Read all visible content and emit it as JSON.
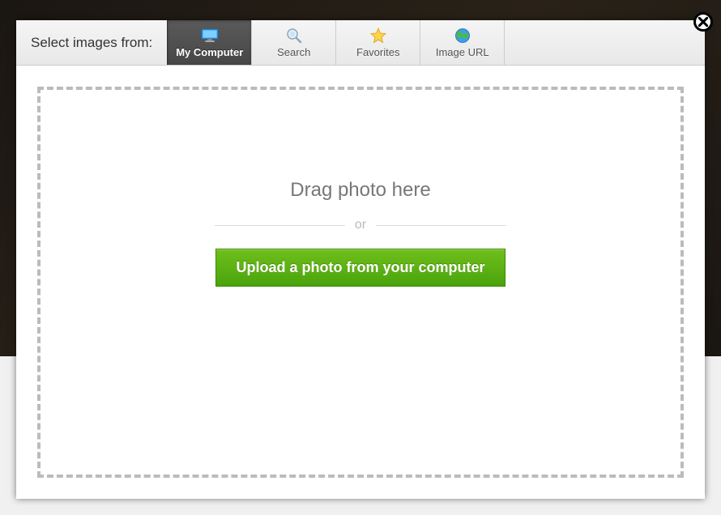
{
  "header": {
    "prompt": "Select images from:"
  },
  "tabs": [
    {
      "id": "my-computer",
      "label": "My Computer",
      "active": true
    },
    {
      "id": "search",
      "label": "Search",
      "active": false
    },
    {
      "id": "favorites",
      "label": "Favorites",
      "active": false
    },
    {
      "id": "image-url",
      "label": "Image URL",
      "active": false
    }
  ],
  "dropzone": {
    "drag_text": "Drag photo here",
    "or_text": "or",
    "upload_button": "Upload a photo from your computer"
  },
  "colors": {
    "accent_green": "#5ab411",
    "dashed_border": "#bbbbbb"
  }
}
